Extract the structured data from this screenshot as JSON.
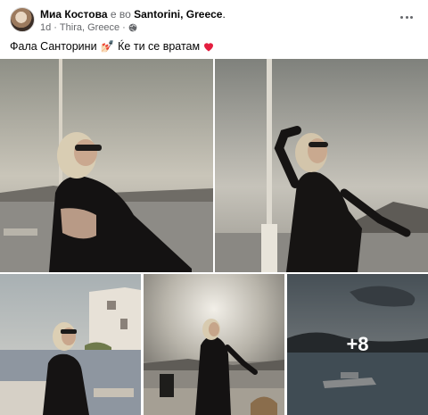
{
  "post": {
    "author": "Миа Костова",
    "connector": "е во",
    "place": "Santorini, Greece",
    "place_suffix": ".",
    "time": "1d",
    "separator": "·",
    "location": "Thira, Greece",
    "separator2": "·",
    "audience_icon": "globe-icon",
    "caption_part1": "Фала Санторини",
    "caption_emoji1": "💅🏻",
    "caption_part2": "Ќе ти се вратам",
    "caption_emoji2": "❤️"
  },
  "gallery": {
    "photo_count_shown": 5,
    "more_count": "+8"
  },
  "colors": {
    "text_primary": "#050505",
    "text_secondary": "#65676b",
    "overlay": "rgba(0,0,0,0.42)",
    "heart": "#e41e3f"
  }
}
